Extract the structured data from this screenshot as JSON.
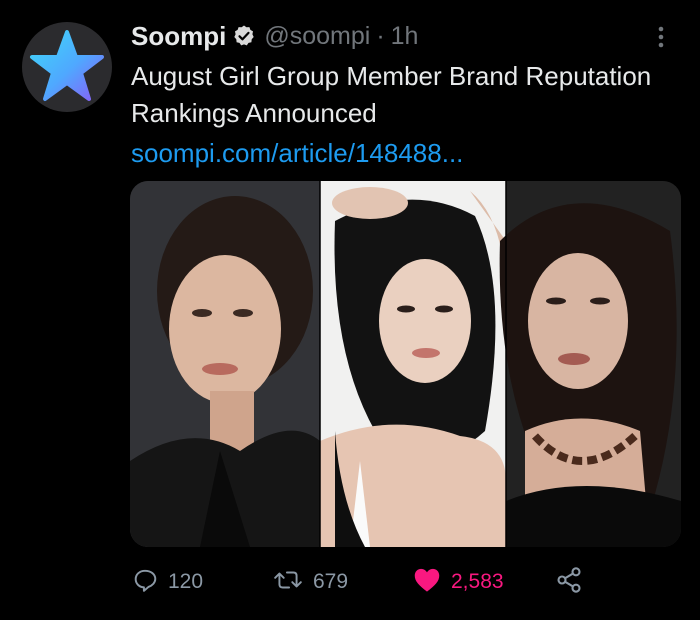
{
  "tweet": {
    "display_name": "Soompi",
    "handle": "@soompi",
    "separator": "·",
    "time": "1h",
    "text": "August Girl Group Member Brand Reputation Rankings Announced",
    "link": "soompi.com/article/148488..."
  },
  "actions": {
    "replies": "120",
    "retweets": "679",
    "likes": "2,583"
  },
  "icons": {
    "avatar_logo": "star-icon",
    "verified": "verified-badge-icon",
    "more": "more-vertical-icon",
    "reply": "reply-icon",
    "retweet": "retweet-icon",
    "like": "heart-icon",
    "share": "share-icon"
  },
  "colors": {
    "background": "#000000",
    "text": "#e7e9ea",
    "muted": "#71767b",
    "link": "#1d9bf0",
    "like": "#f91880",
    "action_muted": "#8b98a5"
  }
}
